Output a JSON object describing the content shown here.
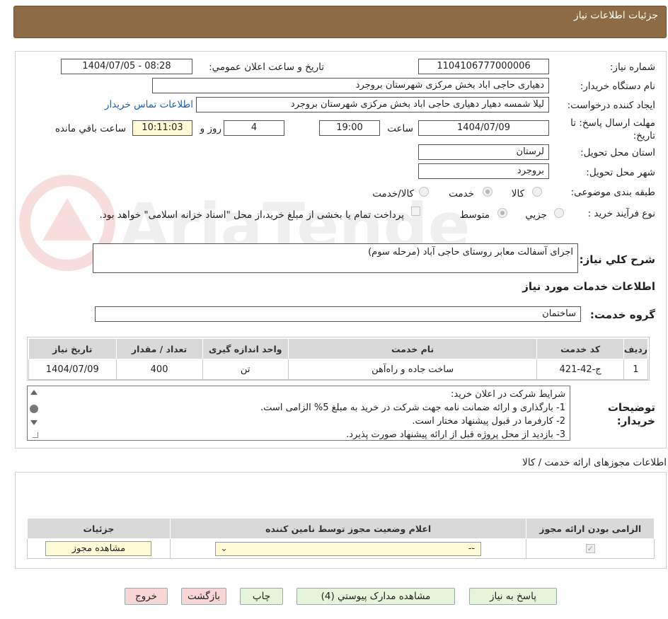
{
  "header": {
    "title": "جزئیات اطلاعات نیاز"
  },
  "form": {
    "need_number_label": "شماره نیاز:",
    "need_number": "1104106777000006",
    "announce_label": "تاریخ و ساعت اعلان عمومي:",
    "announce_value": "1404/07/05 - 08:28",
    "buyer_org_label": "نام دستگاه خريدار:",
    "buyer_org": "دهیاری حاجی اباد بخش مرکزی شهرستان بروجرد",
    "creator_label": "ايجاد کننده درخواست:",
    "creator": "لیلا شمسه دهیار دهیاری حاجی اباد بخش مرکزی شهرستان بروجرد",
    "contact_link": "اطلاعات تماس خريدار",
    "deadline_label": "مهلت ارسال پاسخ: تا تاريخ:",
    "deadline_date": "1404/07/09",
    "time_label": "ساعت",
    "deadline_time": "19:00",
    "days_value": "4",
    "days_label": "روز و",
    "remaining_time": "10:11:03",
    "remaining_label": "ساعت باقي مانده",
    "province_label": "استان محل تحويل:",
    "province": "لرستان",
    "city_label": "شهر محل تحويل:",
    "city": "بروجرد",
    "category_label": "طبقه بندی موضوعی:",
    "category_options": [
      "کالا",
      "خدمت",
      "کالا/خدمت"
    ],
    "process_label": "نوع فرآيند خريد :",
    "process_options": [
      "جزيي",
      "متوسط"
    ],
    "payment_note": "پرداخت تمام یا بخشی از مبلغ خرید،از محل \"اسناد خزانه اسلامی\" خواهد بود.",
    "description_label": "شرح کلي نياز:",
    "description": "اجرای آسفالت معابر روستای حاجی آباد (مرحله سوم)",
    "services_heading": "اطلاعات خدمات مورد نياز",
    "service_group_label": "گروه خدمت:",
    "service_group": "ساختمان"
  },
  "services_table": {
    "headers": [
      "رديف",
      "کد خدمت",
      "نام خدمت",
      "واحد اندازه گيری",
      "تعداد / مقدار",
      "تاريخ نياز"
    ],
    "rows": [
      [
        "1",
        "ج-42-421",
        "ساخت جاده و راه‌آهن",
        "تن",
        "400",
        "1404/07/09"
      ]
    ]
  },
  "notes": {
    "label": "توضيحات خريدار:",
    "lines": [
      "شرایط شرکت در اعلان خرید:",
      "1-     بارگذاری و ارائه ضمانت نامه جهت شرکت در خرید به مبلغ 5% الزامی است.",
      "2-     کارفرما در قبول پیشنهاد مختار است.",
      "3-     بازدید از محل پروژه قبل از ارائه پیشنهاد صورت پذیرد."
    ]
  },
  "permits": {
    "heading": "اطلاعات مجوزهای ارائه خدمت / کالا",
    "headers": [
      "الزامی بودن ارائه مجوز",
      "اعلام وضعیت مجوز توسط نامین کننده",
      "جزئيات"
    ],
    "select_value": "--",
    "view_button": "مشاهده مجوز"
  },
  "buttons": {
    "reply": "پاسخ به نياز",
    "attachments": "مشاهده مدارک پيوستي (4)",
    "print": "چاپ",
    "back": "بازگشت",
    "exit": "خروج"
  },
  "watermark_text": "AriaTender.neT",
  "colors": {
    "header": "#8c6b45",
    "time_bg": "#fffbd6",
    "green_btn": "#e6f4d9",
    "pink_btn": "#f9d6d6"
  }
}
